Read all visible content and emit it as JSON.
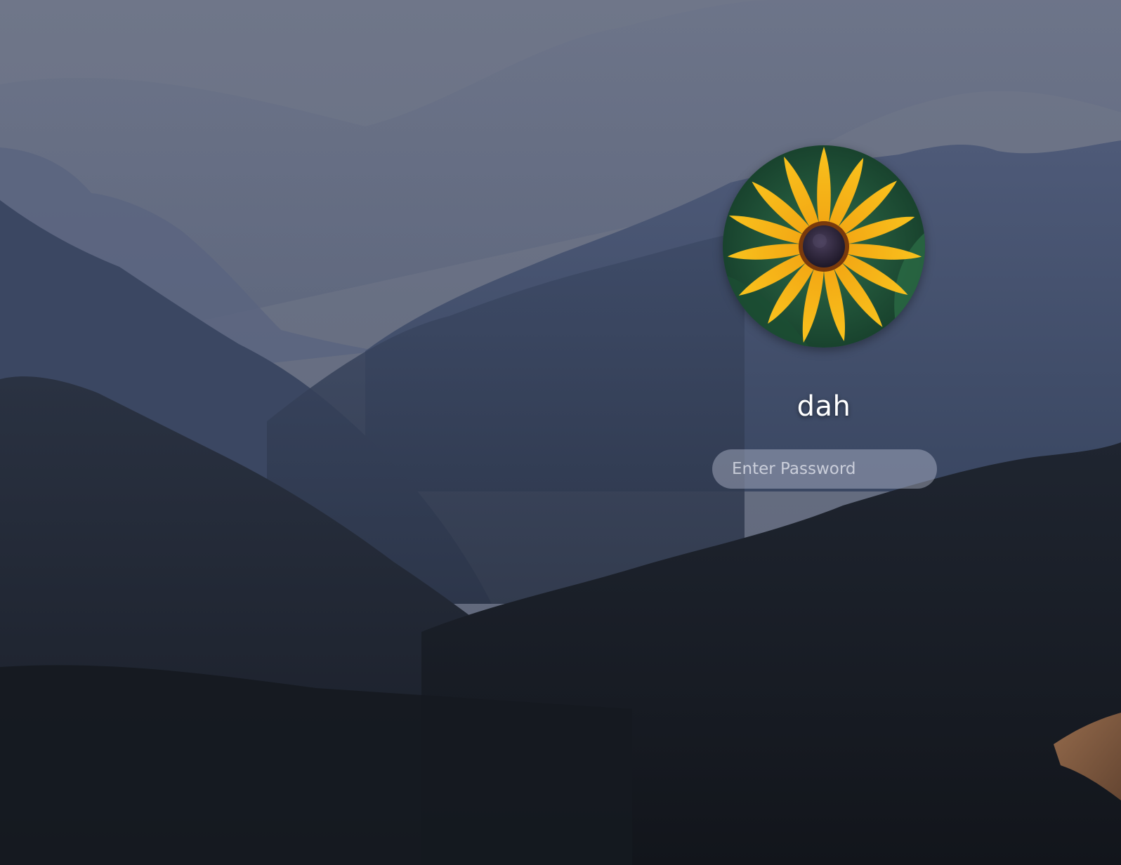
{
  "login": {
    "username": "dah",
    "password_placeholder": "Enter Password",
    "password_value": ""
  },
  "avatar": {
    "icon": "sunflower-icon"
  },
  "wallpaper": {
    "subject": "mountain-ridges"
  },
  "colors": {
    "sky": "#6b7286",
    "ridge_far": "#5a6380",
    "ridge_mid": "#3b4863",
    "ridge_dark": "#1b202b",
    "petal": "#f5b81a",
    "flower_center": "#2a2236",
    "leaf_bg": "#1d5a3c"
  }
}
